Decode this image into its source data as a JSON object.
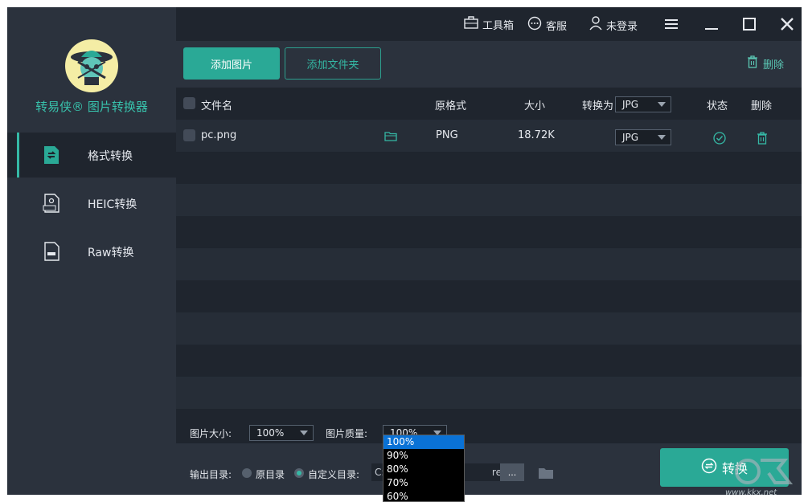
{
  "app": {
    "title": "转易侠® 图片转换器"
  },
  "sidebar": {
    "items": [
      {
        "label": "格式转换",
        "icon": "format-convert-icon",
        "active": true
      },
      {
        "label": "HEIC转换",
        "icon": "heic-icon",
        "active": false
      },
      {
        "label": "Raw转换",
        "icon": "raw-icon",
        "active": false
      }
    ]
  },
  "titlebar": {
    "toolbox": "工具箱",
    "service": "客服",
    "login": "未登录"
  },
  "toolbar": {
    "add_image": "添加图片",
    "add_folder": "添加文件夹",
    "delete": "删除"
  },
  "table": {
    "headers": {
      "filename": "文件名",
      "original_format": "原格式",
      "size": "大小",
      "convert_to": "转换为",
      "convert_to_value": "JPG",
      "status": "状态",
      "delete": "删除"
    },
    "rows": [
      {
        "filename": "pc.png",
        "format": "PNG",
        "size": "18.72K",
        "target": "JPG",
        "status": "done"
      }
    ]
  },
  "settings": {
    "size_label": "图片大小:",
    "size_value": "100%",
    "quality_label": "图片质量:",
    "quality_value": "100%",
    "quality_options": [
      "100%",
      "90%",
      "80%",
      "70%",
      "60%"
    ]
  },
  "output": {
    "label": "输出目录:",
    "original_dir": "原目录",
    "custom_dir": "自定义目录:",
    "path": "C:                                   res",
    "browse": "...",
    "convert": "转换"
  },
  "watermark": {
    "text": "www.kkx.net"
  },
  "colors": {
    "accent": "#2aa996",
    "sidebar_bg": "#2b323d",
    "main_bg": "#1f252e",
    "dropdown_selected": "#0a72d6"
  }
}
